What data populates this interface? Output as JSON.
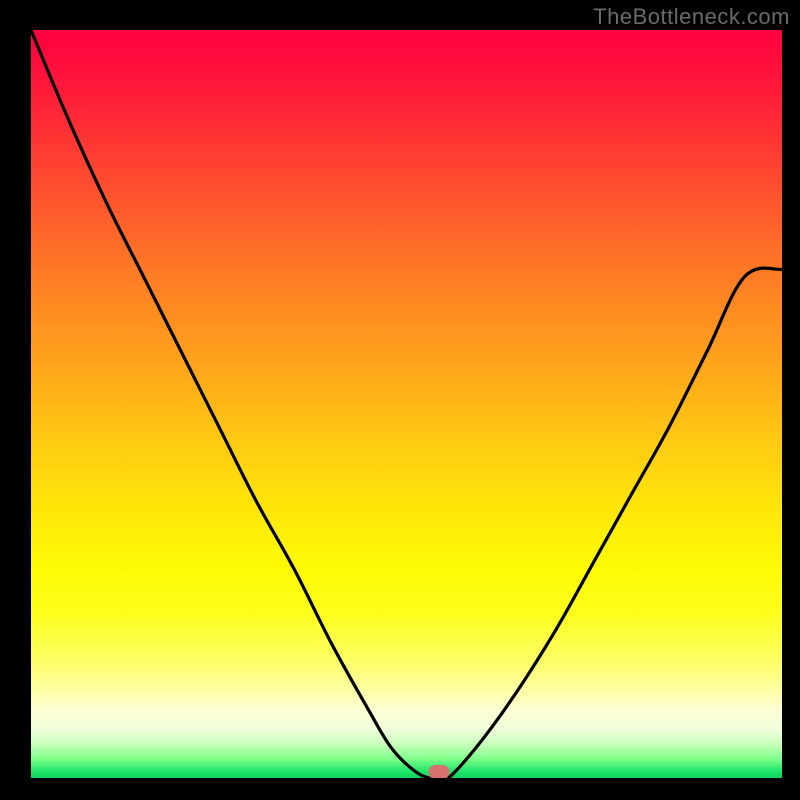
{
  "watermark": "TheBottleneck.com",
  "colors": {
    "frame": "#000000",
    "curve": "#000000",
    "dot": "#d97070",
    "watermark": "#6a6a6a"
  },
  "chart_data": {
    "type": "line",
    "title": "",
    "xlabel": "",
    "ylabel": "",
    "xlim": [
      0,
      100
    ],
    "ylim": [
      0,
      100
    ],
    "grid": false,
    "legend": false,
    "series": [
      {
        "name": "bottleneck-curve",
        "x": [
          0,
          5,
          10,
          15,
          20,
          25,
          30,
          35,
          40,
          45,
          48,
          51,
          53,
          54.3,
          55.6,
          60,
          65,
          70,
          75,
          80,
          85,
          90,
          95,
          100
        ],
        "y": [
          100,
          88,
          77,
          67,
          57,
          47,
          37,
          28,
          18,
          9,
          4,
          1,
          0,
          0,
          0,
          5,
          12,
          20,
          29,
          38,
          47,
          57,
          67,
          68
        ]
      }
    ],
    "marker": {
      "x": 54.3,
      "y": 0,
      "color": "#d97070"
    }
  }
}
